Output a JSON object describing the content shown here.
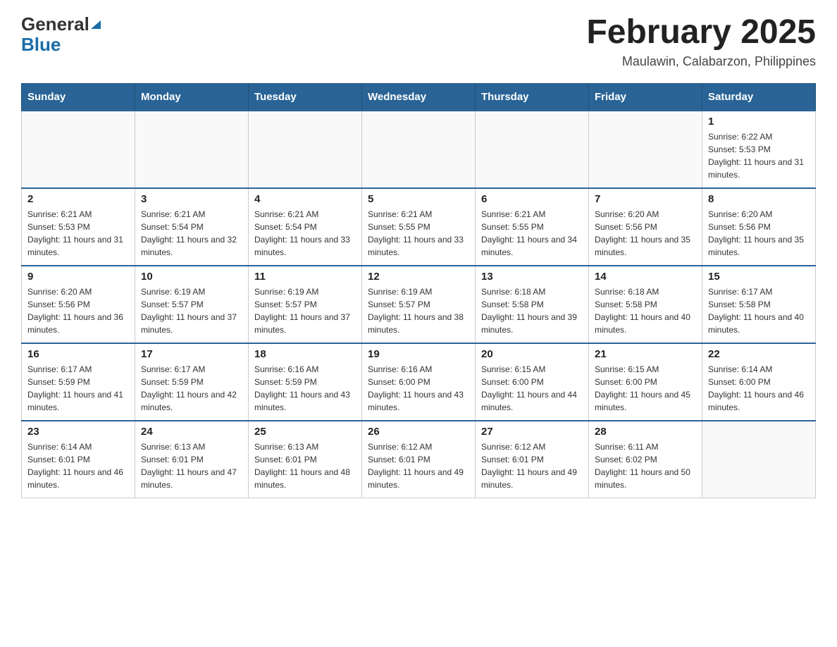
{
  "header": {
    "logo": {
      "general": "General",
      "blue": "Blue"
    },
    "title": "February 2025",
    "subtitle": "Maulawin, Calabarzon, Philippines"
  },
  "days_of_week": [
    "Sunday",
    "Monday",
    "Tuesday",
    "Wednesday",
    "Thursday",
    "Friday",
    "Saturday"
  ],
  "weeks": [
    [
      {
        "day": "",
        "info": ""
      },
      {
        "day": "",
        "info": ""
      },
      {
        "day": "",
        "info": ""
      },
      {
        "day": "",
        "info": ""
      },
      {
        "day": "",
        "info": ""
      },
      {
        "day": "",
        "info": ""
      },
      {
        "day": "1",
        "info": "Sunrise: 6:22 AM\nSunset: 5:53 PM\nDaylight: 11 hours and 31 minutes."
      }
    ],
    [
      {
        "day": "2",
        "info": "Sunrise: 6:21 AM\nSunset: 5:53 PM\nDaylight: 11 hours and 31 minutes."
      },
      {
        "day": "3",
        "info": "Sunrise: 6:21 AM\nSunset: 5:54 PM\nDaylight: 11 hours and 32 minutes."
      },
      {
        "day": "4",
        "info": "Sunrise: 6:21 AM\nSunset: 5:54 PM\nDaylight: 11 hours and 33 minutes."
      },
      {
        "day": "5",
        "info": "Sunrise: 6:21 AM\nSunset: 5:55 PM\nDaylight: 11 hours and 33 minutes."
      },
      {
        "day": "6",
        "info": "Sunrise: 6:21 AM\nSunset: 5:55 PM\nDaylight: 11 hours and 34 minutes."
      },
      {
        "day": "7",
        "info": "Sunrise: 6:20 AM\nSunset: 5:56 PM\nDaylight: 11 hours and 35 minutes."
      },
      {
        "day": "8",
        "info": "Sunrise: 6:20 AM\nSunset: 5:56 PM\nDaylight: 11 hours and 35 minutes."
      }
    ],
    [
      {
        "day": "9",
        "info": "Sunrise: 6:20 AM\nSunset: 5:56 PM\nDaylight: 11 hours and 36 minutes."
      },
      {
        "day": "10",
        "info": "Sunrise: 6:19 AM\nSunset: 5:57 PM\nDaylight: 11 hours and 37 minutes."
      },
      {
        "day": "11",
        "info": "Sunrise: 6:19 AM\nSunset: 5:57 PM\nDaylight: 11 hours and 37 minutes."
      },
      {
        "day": "12",
        "info": "Sunrise: 6:19 AM\nSunset: 5:57 PM\nDaylight: 11 hours and 38 minutes."
      },
      {
        "day": "13",
        "info": "Sunrise: 6:18 AM\nSunset: 5:58 PM\nDaylight: 11 hours and 39 minutes."
      },
      {
        "day": "14",
        "info": "Sunrise: 6:18 AM\nSunset: 5:58 PM\nDaylight: 11 hours and 40 minutes."
      },
      {
        "day": "15",
        "info": "Sunrise: 6:17 AM\nSunset: 5:58 PM\nDaylight: 11 hours and 40 minutes."
      }
    ],
    [
      {
        "day": "16",
        "info": "Sunrise: 6:17 AM\nSunset: 5:59 PM\nDaylight: 11 hours and 41 minutes."
      },
      {
        "day": "17",
        "info": "Sunrise: 6:17 AM\nSunset: 5:59 PM\nDaylight: 11 hours and 42 minutes."
      },
      {
        "day": "18",
        "info": "Sunrise: 6:16 AM\nSunset: 5:59 PM\nDaylight: 11 hours and 43 minutes."
      },
      {
        "day": "19",
        "info": "Sunrise: 6:16 AM\nSunset: 6:00 PM\nDaylight: 11 hours and 43 minutes."
      },
      {
        "day": "20",
        "info": "Sunrise: 6:15 AM\nSunset: 6:00 PM\nDaylight: 11 hours and 44 minutes."
      },
      {
        "day": "21",
        "info": "Sunrise: 6:15 AM\nSunset: 6:00 PM\nDaylight: 11 hours and 45 minutes."
      },
      {
        "day": "22",
        "info": "Sunrise: 6:14 AM\nSunset: 6:00 PM\nDaylight: 11 hours and 46 minutes."
      }
    ],
    [
      {
        "day": "23",
        "info": "Sunrise: 6:14 AM\nSunset: 6:01 PM\nDaylight: 11 hours and 46 minutes."
      },
      {
        "day": "24",
        "info": "Sunrise: 6:13 AM\nSunset: 6:01 PM\nDaylight: 11 hours and 47 minutes."
      },
      {
        "day": "25",
        "info": "Sunrise: 6:13 AM\nSunset: 6:01 PM\nDaylight: 11 hours and 48 minutes."
      },
      {
        "day": "26",
        "info": "Sunrise: 6:12 AM\nSunset: 6:01 PM\nDaylight: 11 hours and 49 minutes."
      },
      {
        "day": "27",
        "info": "Sunrise: 6:12 AM\nSunset: 6:01 PM\nDaylight: 11 hours and 49 minutes."
      },
      {
        "day": "28",
        "info": "Sunrise: 6:11 AM\nSunset: 6:02 PM\nDaylight: 11 hours and 50 minutes."
      },
      {
        "day": "",
        "info": ""
      }
    ]
  ]
}
